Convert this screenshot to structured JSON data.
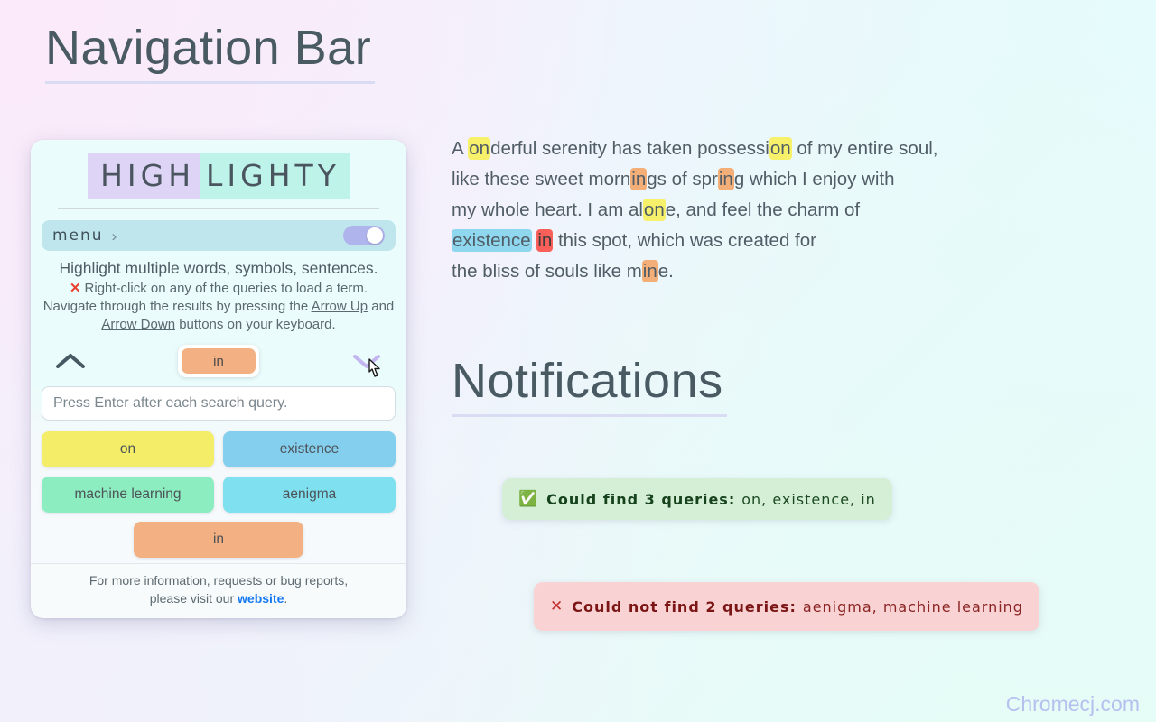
{
  "headings": {
    "nav": "Navigation Bar",
    "notifications": "Notifications"
  },
  "popup": {
    "logo": {
      "part_a": "HIGH",
      "part_b": "LIGHTY"
    },
    "menu": {
      "label": "menu",
      "chevron": "›",
      "toggle_on": true
    },
    "tagline": "Highlight multiple words, symbols, sentences.",
    "hint": {
      "x_mark": "✕",
      "line1": "Right-click on any of the queries to load a term.",
      "line2_pre": "Navigate through the results by pressing the ",
      "link1": "Arrow Up",
      "line2_mid": " and ",
      "link2": "Arrow Down",
      "line2_post": " buttons on your keyboard."
    },
    "nav_controls": {
      "up_icon": "chevron-up-icon",
      "down_icon": "chevron-down-icon",
      "current_term": "in"
    },
    "search": {
      "value": "",
      "placeholder": "Press Enter after each search query."
    },
    "queries": [
      {
        "label": "on",
        "color": "#f3ed67"
      },
      {
        "label": "existence",
        "color": "#85cfee"
      },
      {
        "label": "machine learning",
        "color": "#8ceec0"
      },
      {
        "label": "aenigma",
        "color": "#7fe1f0"
      },
      {
        "label": "in",
        "color": "#f3b183"
      }
    ],
    "footer": {
      "line1": "For more information, requests or bug reports,",
      "line2_pre": "please visit our ",
      "link": "website",
      "line2_post": "."
    }
  },
  "demo_text": {
    "segments": [
      {
        "t": "A ",
        "h": "none"
      },
      {
        "t": "on",
        "h": "yellow"
      },
      {
        "t": "derful serenity has taken possessi",
        "h": "none"
      },
      {
        "t": "on",
        "h": "yellow"
      },
      {
        "t": " of my entire soul,",
        "h": "none"
      },
      {
        "t": "\n",
        "h": "br"
      },
      {
        "t": "like these sweet morn",
        "h": "none"
      },
      {
        "t": "in",
        "h": "orange"
      },
      {
        "t": "gs of spr",
        "h": "none"
      },
      {
        "t": "in",
        "h": "orange"
      },
      {
        "t": "g which I enjoy with",
        "h": "none"
      },
      {
        "t": "\n",
        "h": "br"
      },
      {
        "t": "my whole heart. I am al",
        "h": "none"
      },
      {
        "t": "on",
        "h": "yellow"
      },
      {
        "t": "e, and feel the charm of",
        "h": "none"
      },
      {
        "t": "\n",
        "h": "br"
      },
      {
        "t": "existence",
        "h": "blue"
      },
      {
        "t": " ",
        "h": "none"
      },
      {
        "t": "in",
        "h": "red"
      },
      {
        "t": " this spot, which was created for",
        "h": "none"
      },
      {
        "t": "\n",
        "h": "br"
      },
      {
        "t": "the bliss of souls like m",
        "h": "none"
      },
      {
        "t": "in",
        "h": "orange"
      },
      {
        "t": "e.",
        "h": "none"
      }
    ]
  },
  "notifications": {
    "success": {
      "icon": "✅",
      "title": "Could find 3 queries:",
      "items": "on, existence, in"
    },
    "error": {
      "icon": "✕",
      "title": "Could not find 2 queries:",
      "items": "aenigma, machine learning"
    }
  },
  "watermark": "Chromecj.com"
}
